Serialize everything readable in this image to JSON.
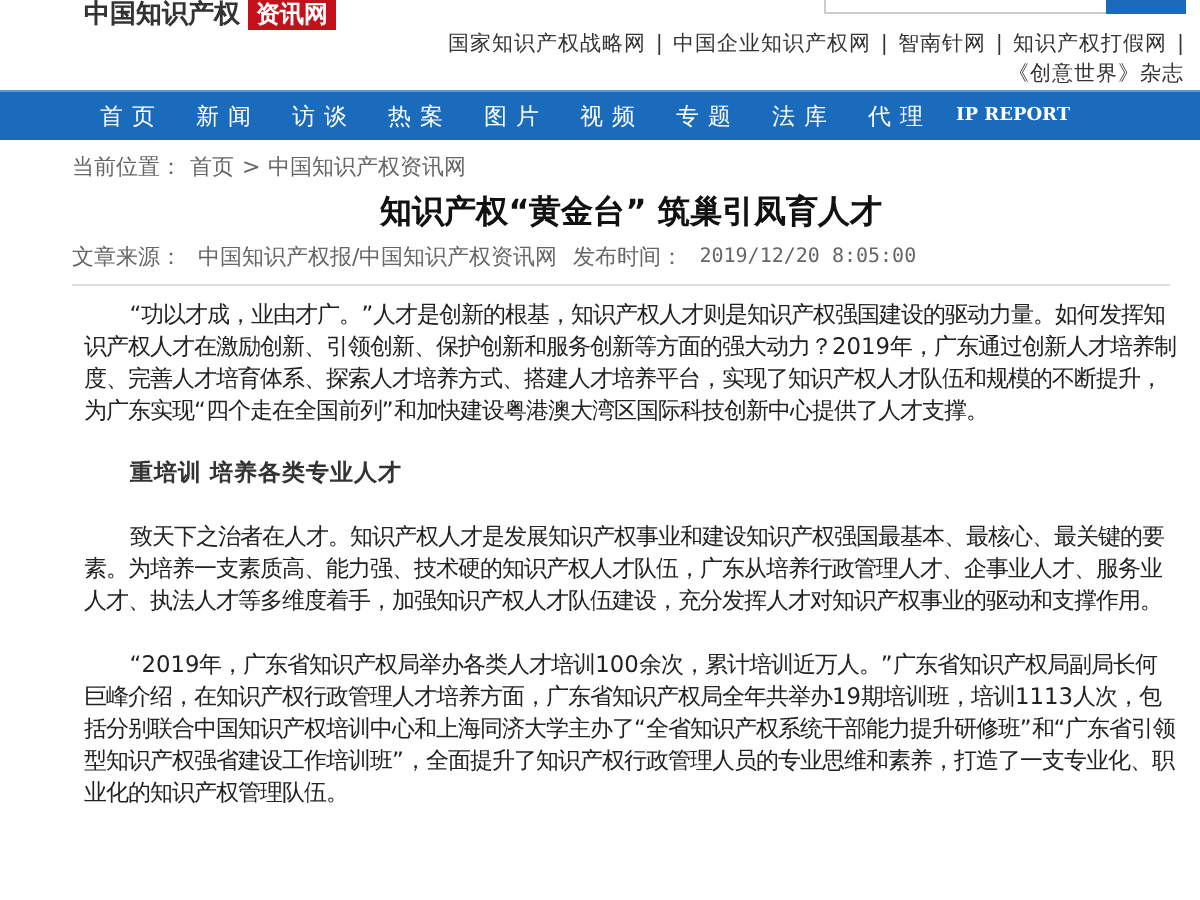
{
  "header": {
    "logo": {
      "name": "中国知识产权",
      "tag": "资讯网"
    },
    "separator": "|",
    "links": [
      "国家知识产权战略网",
      "中国企业知识产权网",
      "智南针网",
      "知识产权打假网",
      "《创意世界》杂志"
    ]
  },
  "nav": [
    "首 页",
    "新 闻",
    "访 谈",
    "热 案",
    "图 片",
    "视 频",
    "专 题",
    "法 库",
    "代 理",
    "IP REPORT"
  ],
  "breadcrumb": {
    "label": "当前位置：",
    "separator": ">",
    "items": [
      "首页",
      "中国知识产权资讯网"
    ]
  },
  "article": {
    "title": "知识产权“黄金台” 筑巢引凤育人才",
    "source_label": "文章来源：",
    "source": "中国知识产权报/中国知识产权资讯网",
    "time_label": "发布时间：",
    "time": "2019/12/20 8:05:00",
    "sections": [
      {
        "kind": "paragraph",
        "text": "“功以才成，业由才广。”人才是创新的根基，知识产权人才则是知识产权强国建设的驱动力量。如何发挥知识产权人才在激励创新、引领创新、保护创新和服务创新等方面的强大动力？2019年，广东通过创新人才培养制度、完善人才培育体系、探索人才培养方式、搭建人才培养平台，实现了知识产权人才队伍和规模的不断提升，为广东实现“四个走在全国前列”和加快建设粤港澳大湾区国际科技创新中心提供了人才支撑。"
      },
      {
        "kind": "heading",
        "text": "重培训 培养各类专业人才"
      },
      {
        "kind": "paragraph",
        "text": "致天下之治者在人才。知识产权人才是发展知识产权事业和建设知识产权强国最基本、最核心、最关键的要素。为培养一支素质高、能力强、技术硬的知识产权人才队伍，广东从培养行政管理人才、企事业人才、服务业人才、执法人才等多维度着手，加强知识产权人才队伍建设，充分发挥人才对知识产权事业的驱动和支撑作用。"
      },
      {
        "kind": "paragraph",
        "text": "“2019年，广东省知识产权局举办各类人才培训100余次，累计培训近万人。”广东省知识产权局副局长何巨峰介绍，在知识产权行政管理人才培养方面，广东省知识产权局全年共举办19期培训班，培训1113人次，包括分别联合中国知识产权培训中心和上海同济大学主办了“全省知识产权系统干部能力提升研修班”和“广东省引领型知识产权强省建设工作培训班”，全面提升了知识产权行政管理人员的专业思维和素养，打造了一支专业化、职业化的知识产权管理队伍。"
      }
    ]
  }
}
